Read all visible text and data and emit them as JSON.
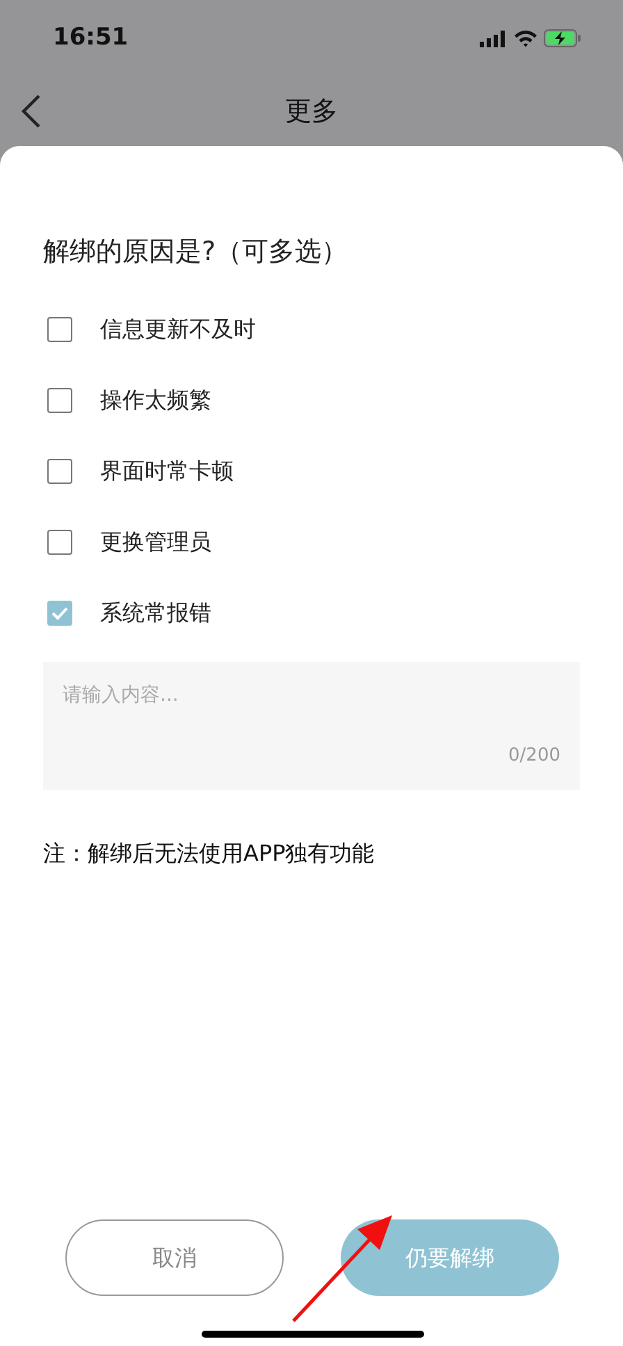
{
  "status_bar": {
    "time": "16:51"
  },
  "nav": {
    "title": "更多"
  },
  "question": "解绑的原因是?（可多选）",
  "options": [
    {
      "label": "信息更新不及时",
      "checked": false
    },
    {
      "label": "操作太频繁",
      "checked": false
    },
    {
      "label": "界面时常卡顿",
      "checked": false
    },
    {
      "label": "更换管理员",
      "checked": false
    },
    {
      "label": "系统常报错",
      "checked": true
    }
  ],
  "comment": {
    "placeholder": "请输入内容...",
    "counter": "0/200"
  },
  "note": "注：解绑后无法使用APP独有功能",
  "buttons": [
    {
      "label": "取消",
      "kind": "secondary"
    },
    {
      "label": "仍要解绑",
      "kind": "primary"
    }
  ]
}
